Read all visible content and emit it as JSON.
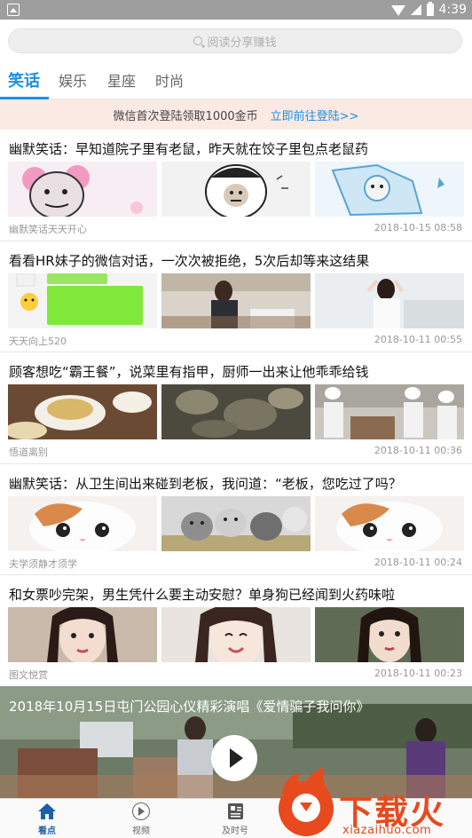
{
  "status_bar": {
    "time": "4:39"
  },
  "search": {
    "placeholder": "阅读分享赚钱"
  },
  "tabs": [
    {
      "label": "笑话",
      "active": true
    },
    {
      "label": "娱乐"
    },
    {
      "label": "星座"
    },
    {
      "label": "时尚"
    }
  ],
  "promo": {
    "text": "微信首次登陆领取1000金币",
    "link": "立即前往登陆>>"
  },
  "articles": [
    {
      "title": "幽默笑话：早知道院子里有老鼠，昨天就在饺子里包点老鼠药",
      "source": "幽默笑话天天开心",
      "time": "2018-10-15 08:58"
    },
    {
      "title": "看看HR妹子的微信对话，一次次被拒绝，5次后却等来这结果",
      "source": "天天向上520",
      "time": "2018-10-11 00:55"
    },
    {
      "title": "顾客想吃“霸王餐”，说菜里有指甲，厨师一出来让他乖乖给钱",
      "source": "悟道离别",
      "time": "2018-10-11 00:36"
    },
    {
      "title": "幽默笑话：从卫生间出来碰到老板，我问道：“老板，您吃过了吗？",
      "source": "夫学须静才须学",
      "time": "2018-10-11 00:24"
    },
    {
      "title": "和女票吵完架，男生凭什么要主动安慰？单身狗已经闻到火药味啦",
      "source": "图文悦赏",
      "time": "2018-10-11 00:23"
    }
  ],
  "video": {
    "title": "2018年10月15日屯门公园心仪精彩演唱《爱情骗子我问你》"
  },
  "bottom_nav": [
    {
      "label": "看点",
      "icon": "home-icon",
      "active": true
    },
    {
      "label": "视频",
      "icon": "video-icon"
    },
    {
      "label": "及时号",
      "icon": "news-icon"
    }
  ],
  "watermark": {
    "name": "下载火",
    "url": "xiazaihuo.com"
  },
  "colors": {
    "accent": "#1b8fe6",
    "promo_bg": "#fbe9e4",
    "watermark": "#e74a1d",
    "status_bar": "#9e9e9e"
  }
}
